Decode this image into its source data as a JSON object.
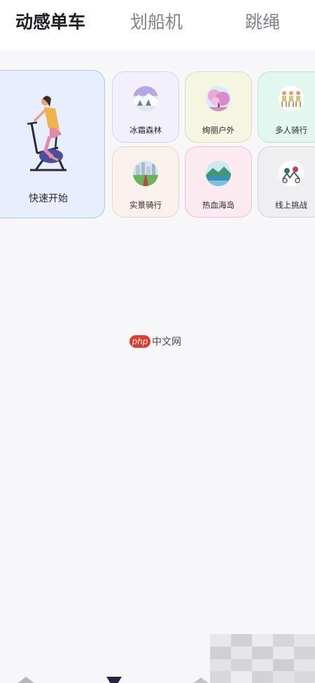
{
  "tabs": [
    {
      "label": "动感单车",
      "active": true
    },
    {
      "label": "划船机",
      "active": false
    },
    {
      "label": "跳绳",
      "active": false
    }
  ],
  "quick_start": {
    "label": "快速开始",
    "icon": "exercise-bike-icon"
  },
  "modes": [
    {
      "label": "冰霜森林",
      "icon": "frost-forest-icon"
    },
    {
      "label": "绚丽户外",
      "icon": "cherry-blossom-icon"
    },
    {
      "label": "多人骑行",
      "icon": "group-riders-icon"
    },
    {
      "label": "实景骑行",
      "icon": "city-road-icon"
    },
    {
      "label": "热血海岛",
      "icon": "island-icon"
    },
    {
      "label": "线上挑战",
      "icon": "online-challenge-icon"
    }
  ],
  "watermark": {
    "badge": "php",
    "text": "中文网"
  },
  "bottom_nav": {
    "icons": [
      "home-icon",
      "workout-icon",
      "profile-icon"
    ]
  },
  "colors": {
    "accent_tab": "#222026",
    "inactive_tab": "#858089",
    "background": "#f7f6f9"
  }
}
